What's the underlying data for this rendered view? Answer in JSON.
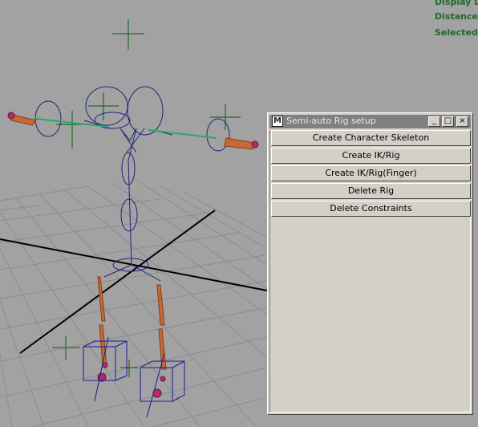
{
  "hud": {
    "lines": [
      "Display Lo",
      "Distance",
      "Selected"
    ],
    "color": "#1d6b2b"
  },
  "rig_window": {
    "title": "Semi-auto Rig setup",
    "icon": "maya-window-icon",
    "controls": {
      "minimize": "_",
      "maximize": "□",
      "close": "×"
    },
    "buttons": [
      {
        "label": "Create Character Skeleton"
      },
      {
        "label": "Create IK/Rig"
      },
      {
        "label": "Create IK/Rig(Finger)"
      },
      {
        "label": "Delete Rig"
      },
      {
        "label": "Delete Constraints"
      }
    ]
  },
  "viewport": {
    "background": "#a2a2a2",
    "grid_color": "#8a8a8a",
    "axis_color": "#000000",
    "joint_color": "#23237a",
    "ik_color": "#2aa86a",
    "bone_color": "#c46a35",
    "locator_color": "#1f6b2a"
  }
}
